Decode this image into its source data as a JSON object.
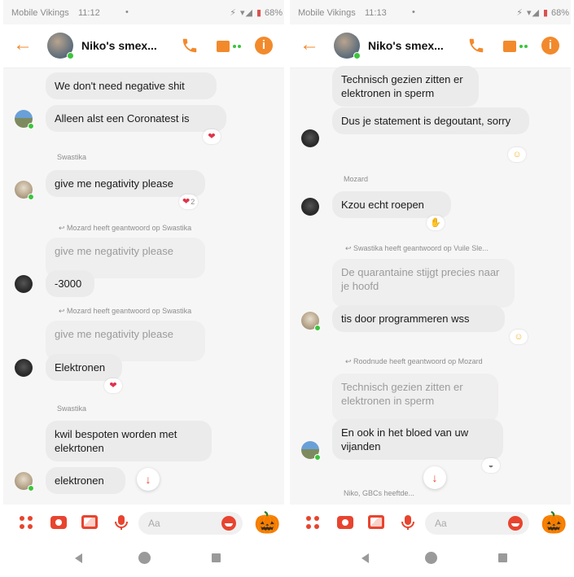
{
  "left": {
    "status": {
      "carrier": "Mobile Vikings",
      "time": "11:12",
      "battery": "68%"
    },
    "header": {
      "title": "Niko's smex..."
    },
    "messages": [
      {
        "text": "We don't need negative shit"
      },
      {
        "text": "Alleen alst een Coronatest is",
        "reaction": "❤"
      },
      {
        "sender": "Swastika"
      },
      {
        "text": "give me negativity please",
        "reaction": "❤",
        "reaction_count": "2"
      },
      {
        "reply_context": "Mozard heeft geantwoord op Swastika",
        "quoted": "give me negativity please",
        "text": "-3000"
      },
      {
        "reply_context": "Mozard heeft geantwoord op Swastika",
        "quoted": "give me negativity please",
        "text": "Elektronen",
        "reaction": "❤"
      },
      {
        "sender": "Swastika"
      },
      {
        "text": "kwil bespoten worden met elekrtonen"
      },
      {
        "text": "elektronen"
      }
    ],
    "composer": {
      "placeholder": "Aa"
    }
  },
  "right": {
    "status": {
      "carrier": "Mobile Vikings",
      "time": "11:13",
      "battery": "68%"
    },
    "header": {
      "title": "Niko's smex..."
    },
    "messages": [
      {
        "text": "Technisch gezien zitten er elektronen in sperm"
      },
      {
        "text": "Dus je statement is degoutant, sorry",
        "reaction": "☺"
      },
      {
        "sender": "Mozard"
      },
      {
        "text": "Kzou echt roepen",
        "reaction": "✋"
      },
      {
        "reply_context": "Swastika heeft geantwoord op Vuile Sle...",
        "quoted": "De quarantaine stijgt precies naar je hoofd",
        "text": "tis door programmeren wss",
        "reaction": "☺"
      },
      {
        "reply_context": "Roodnude heeft geantwoord op Mozard",
        "quoted": "Technisch gezien zitten er elektronen in sperm",
        "text": "En ook in het bloed van uw vijanden",
        "reaction": "◒"
      },
      {
        "typing": "Niko, GBCs heeftde..."
      }
    ],
    "composer": {
      "placeholder": "Aa"
    }
  },
  "colors": {
    "accent": "#f28a2c",
    "composer_red": "#e8442f",
    "bubble": "#ebebeb",
    "online": "#3cc43c"
  },
  "icons": [
    "back-arrow-icon",
    "phone-icon",
    "video-icon",
    "info-icon",
    "apps-grid-icon",
    "camera-icon",
    "gallery-icon",
    "mic-icon",
    "emoji-icon",
    "pumpkin-icon",
    "scroll-down-icon",
    "nav-back-icon",
    "nav-home-icon",
    "nav-recents-icon"
  ]
}
